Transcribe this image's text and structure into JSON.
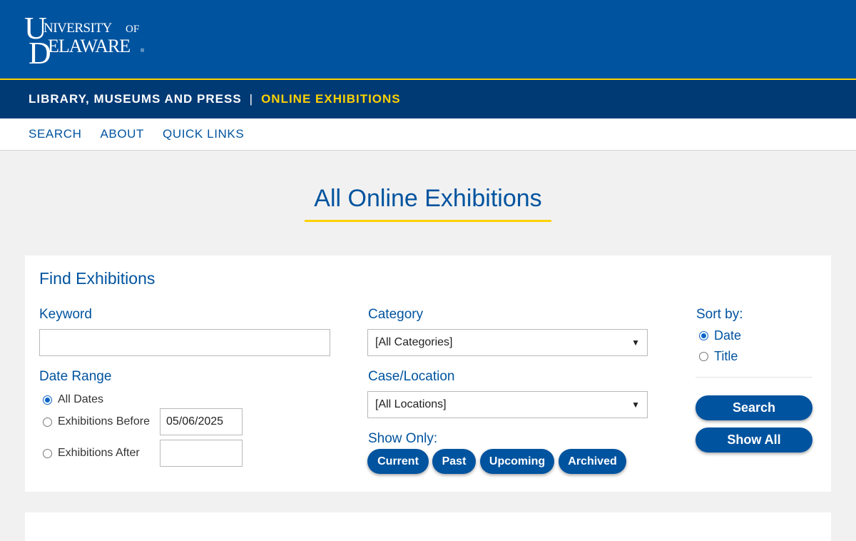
{
  "header": {
    "logo_text": "UNIVERSITY OF DELAWARE",
    "library": "LIBRARY, MUSEUMS AND PRESS",
    "separator": "|",
    "online_exhibitions": "ONLINE EXHIBITIONS"
  },
  "nav": {
    "items": [
      "SEARCH",
      "ABOUT",
      "QUICK LINKS"
    ]
  },
  "page_title": "All Online Exhibitions",
  "find": {
    "title": "Find Exhibitions",
    "keyword_label": "Keyword",
    "keyword_value": "",
    "date_range_label": "Date Range",
    "date_options": [
      "All Dates",
      "Exhibitions Before",
      "Exhibitions After"
    ],
    "before_value": "05/06/2025",
    "after_value": "",
    "category_label": "Category",
    "category_selected": "[All Categories]",
    "location_label": "Case/Location",
    "location_selected": "[All Locations]",
    "show_only_label": "Show Only:",
    "show_only_buttons": [
      "Current",
      "Past",
      "Upcoming",
      "Archived"
    ],
    "sort_label": "Sort by:",
    "sort_options": [
      "Date",
      "Title"
    ],
    "search_button": "Search",
    "show_all_button": "Show All"
  },
  "colors": {
    "brand_blue": "#00539f",
    "navy": "#003a75",
    "gold": "#ffd200"
  },
  "icons": {
    "select_arrow": "chevron-down-icon"
  }
}
